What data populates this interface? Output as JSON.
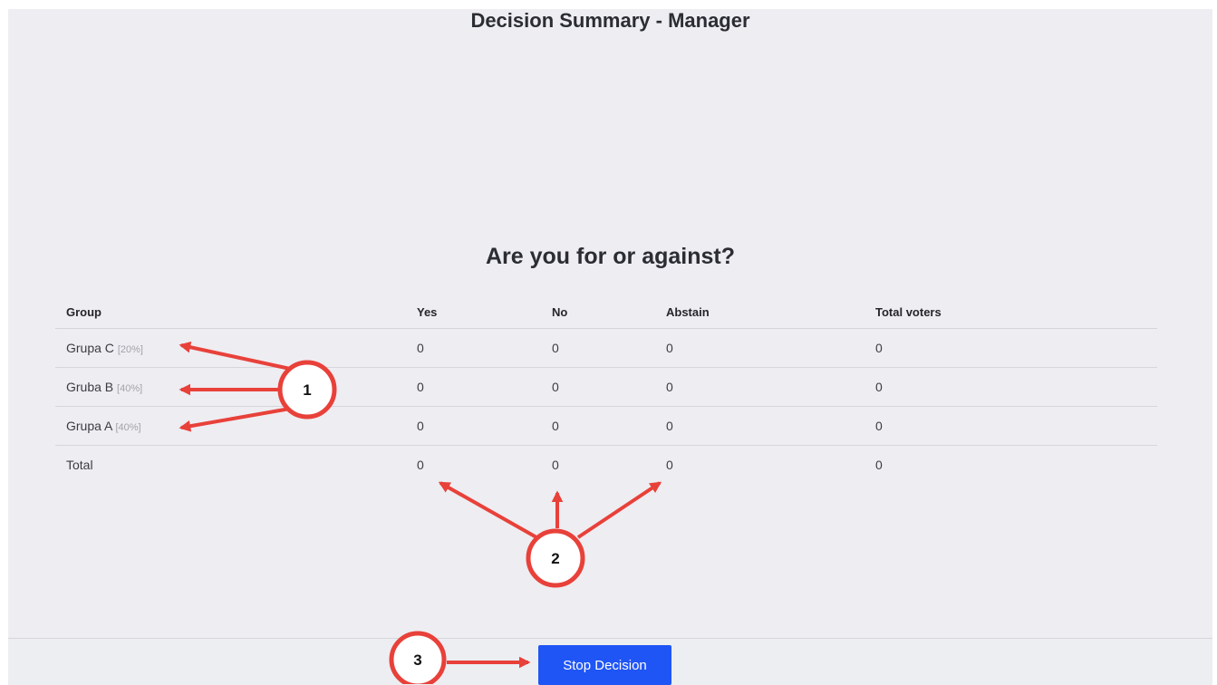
{
  "page": {
    "title": "Decision Summary - Manager",
    "question": "Are you for or against?"
  },
  "table": {
    "headers": {
      "group": "Group",
      "yes": "Yes",
      "no": "No",
      "abstain": "Abstain",
      "total_voters": "Total voters"
    },
    "rows": [
      {
        "group": "Grupa C",
        "weight": "[20%]",
        "yes": "0",
        "no": "0",
        "abstain": "0",
        "total_voters": "0"
      },
      {
        "group": "Gruba B",
        "weight": "[40%]",
        "yes": "0",
        "no": "0",
        "abstain": "0",
        "total_voters": "0"
      },
      {
        "group": "Grupa A",
        "weight": "[40%]",
        "yes": "0",
        "no": "0",
        "abstain": "0",
        "total_voters": "0"
      }
    ],
    "total": {
      "label": "Total",
      "yes": "0",
      "no": "0",
      "abstain": "0",
      "total_voters": "0"
    }
  },
  "footer": {
    "stop_label": "Stop Decision"
  },
  "annotations": {
    "marker_1": "1",
    "marker_2": "2",
    "marker_3": "3"
  },
  "colors": {
    "background": "#eeedf1",
    "button": "#1f55f5",
    "annotation": "#e8413a"
  }
}
